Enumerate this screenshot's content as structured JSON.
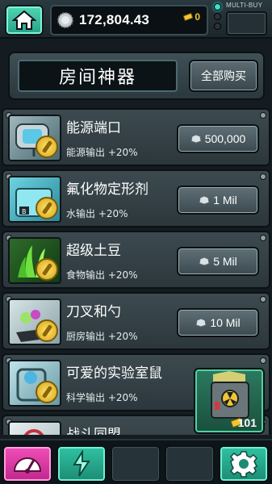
{
  "topbar": {
    "currency_value": "172,804.43",
    "gold_value": "0",
    "multibuy_label": "MULTI-BUY"
  },
  "header": {
    "title": "房间神器",
    "buy_all_label": "全部购买"
  },
  "items": [
    {
      "name": "能源端口",
      "desc": "能源输出 +20%",
      "price": "500,000"
    },
    {
      "name": "氟化物定形剂",
      "desc": "水输出 +20%",
      "price": "1 Mil"
    },
    {
      "name": "超级土豆",
      "desc": "食物输出 +20%",
      "price": "5 Mil"
    },
    {
      "name": "刀叉和勺",
      "desc": "厨房输出 +20%",
      "price": "10 Mil"
    },
    {
      "name": "可爱的实验室鼠",
      "desc": "科学输出 +20%",
      "price": ""
    },
    {
      "name": "战斗同盟",
      "desc": "",
      "price": ""
    }
  ],
  "lootbox": {
    "count": "101"
  },
  "colors": {
    "accent_teal": "#2fc3a3",
    "accent_pink": "#f04fb8",
    "panel": "#3c4a50",
    "gold": "#f0c534"
  },
  "icons": {
    "home": "home-icon",
    "currency": "nuka-cap-icon",
    "gold": "lunchbox-ticket-icon",
    "nav": [
      "gauge-icon",
      "power-icon",
      "empty-slot",
      "empty-slot",
      "gear-icon"
    ]
  }
}
